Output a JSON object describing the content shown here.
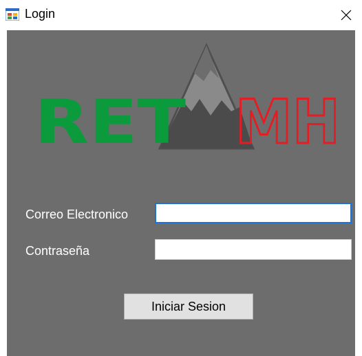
{
  "window": {
    "title": "Login",
    "app_icon": "windows-form-icon",
    "close_icon": "close-icon"
  },
  "logo": {
    "left_text": "RET",
    "right_text": "MH",
    "left_color": "#0b9a3c",
    "right_color": "#e51c24",
    "mountain_icon": "mountain-icon"
  },
  "form": {
    "email_label": "Correo Electronico",
    "email_value": "",
    "password_label": "Contraseña",
    "password_value": "",
    "submit_label": "Iniciar Sesion"
  },
  "colors": {
    "client_background": "#6d6d6d",
    "focus_border": "#1a73d9"
  }
}
